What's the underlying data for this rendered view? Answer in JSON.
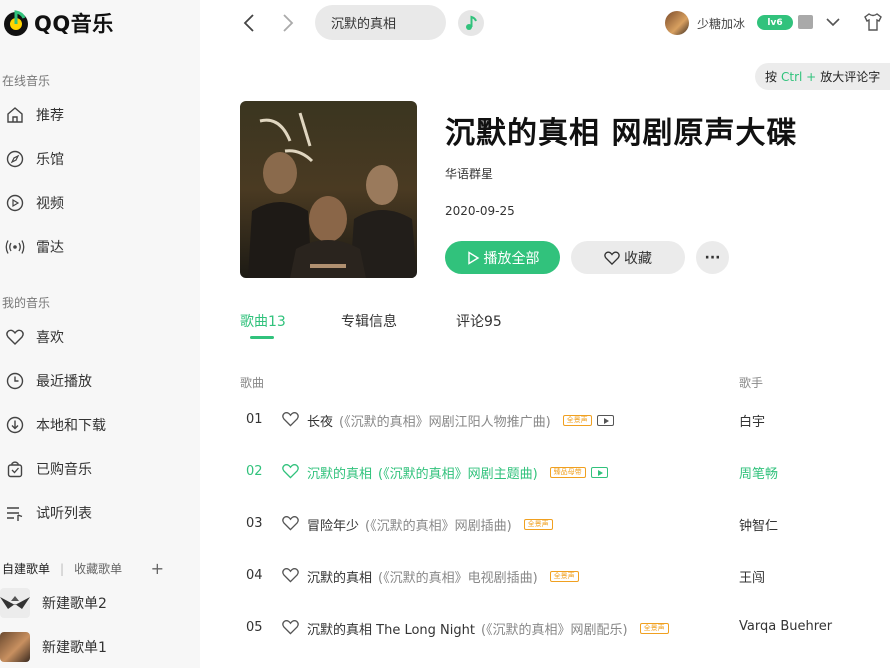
{
  "app": {
    "name": "QQ音乐",
    "accent": "#31c27c"
  },
  "sidebar": {
    "online_title": "在线音乐",
    "online_items": [
      {
        "label": "推荐",
        "icon": "home-icon"
      },
      {
        "label": "乐馆",
        "icon": "compass-icon"
      },
      {
        "label": "视频",
        "icon": "video-icon"
      },
      {
        "label": "雷达",
        "icon": "radar-icon"
      }
    ],
    "my_title": "我的音乐",
    "my_items": [
      {
        "label": "喜欢",
        "icon": "heart-icon"
      },
      {
        "label": "最近播放",
        "icon": "clock-icon"
      },
      {
        "label": "本地和下载",
        "icon": "download-icon"
      },
      {
        "label": "已购音乐",
        "icon": "bag-icon"
      },
      {
        "label": "试听列表",
        "icon": "list-icon"
      }
    ],
    "playlist_tabs": {
      "created": "自建歌单",
      "separator": "|",
      "collected": "收藏歌单",
      "add": "+"
    },
    "playlists": [
      {
        "name": "新建歌单2"
      },
      {
        "name": "新建歌单1"
      }
    ]
  },
  "topbar": {
    "search_value": "沉默的真相",
    "username": "少糖加冰",
    "vip_badge": "lv6"
  },
  "zoom_hint": {
    "prefix": "按",
    "key": "Ctrl +",
    "text": "放大评论字"
  },
  "album": {
    "title": "沉默的真相 网剧原声大碟",
    "artist": "华语群星",
    "date": "2020-09-25",
    "play_all": "播放全部",
    "favorite": "收藏",
    "more": "···"
  },
  "tabs": [
    {
      "label": "歌曲13",
      "active": true
    },
    {
      "label": "专辑信息",
      "active": false
    },
    {
      "label": "评论95",
      "active": false
    }
  ],
  "list": {
    "col_song": "歌曲",
    "col_singer": "歌手",
    "songs": [
      {
        "num": "01",
        "title": "长夜",
        "subtitle": "(《沉默的真相》网剧江阳人物推广曲)",
        "tag": "全景声",
        "mv": true,
        "singer": "白宇",
        "playing": false
      },
      {
        "num": "02",
        "title": "沉默的真相",
        "subtitle": "(《沉默的真相》网剧主题曲)",
        "tag": "臻品母带",
        "mv": true,
        "singer": "周笔畅",
        "playing": true
      },
      {
        "num": "03",
        "title": "冒险年少",
        "subtitle": "(《沉默的真相》网剧插曲)",
        "tag": "全景声",
        "mv": false,
        "singer": "钟智仁",
        "playing": false
      },
      {
        "num": "04",
        "title": "沉默的真相",
        "subtitle": "(《沉默的真相》电视剧插曲)",
        "tag": "全景声",
        "mv": false,
        "singer": "王闯",
        "playing": false
      },
      {
        "num": "05",
        "title": "沉默的真相 The Long Night",
        "subtitle": "(《沉默的真相》网剧配乐)",
        "tag": "全景声",
        "mv": false,
        "singer": "Varqa Buehrer",
        "playing": false
      }
    ]
  }
}
